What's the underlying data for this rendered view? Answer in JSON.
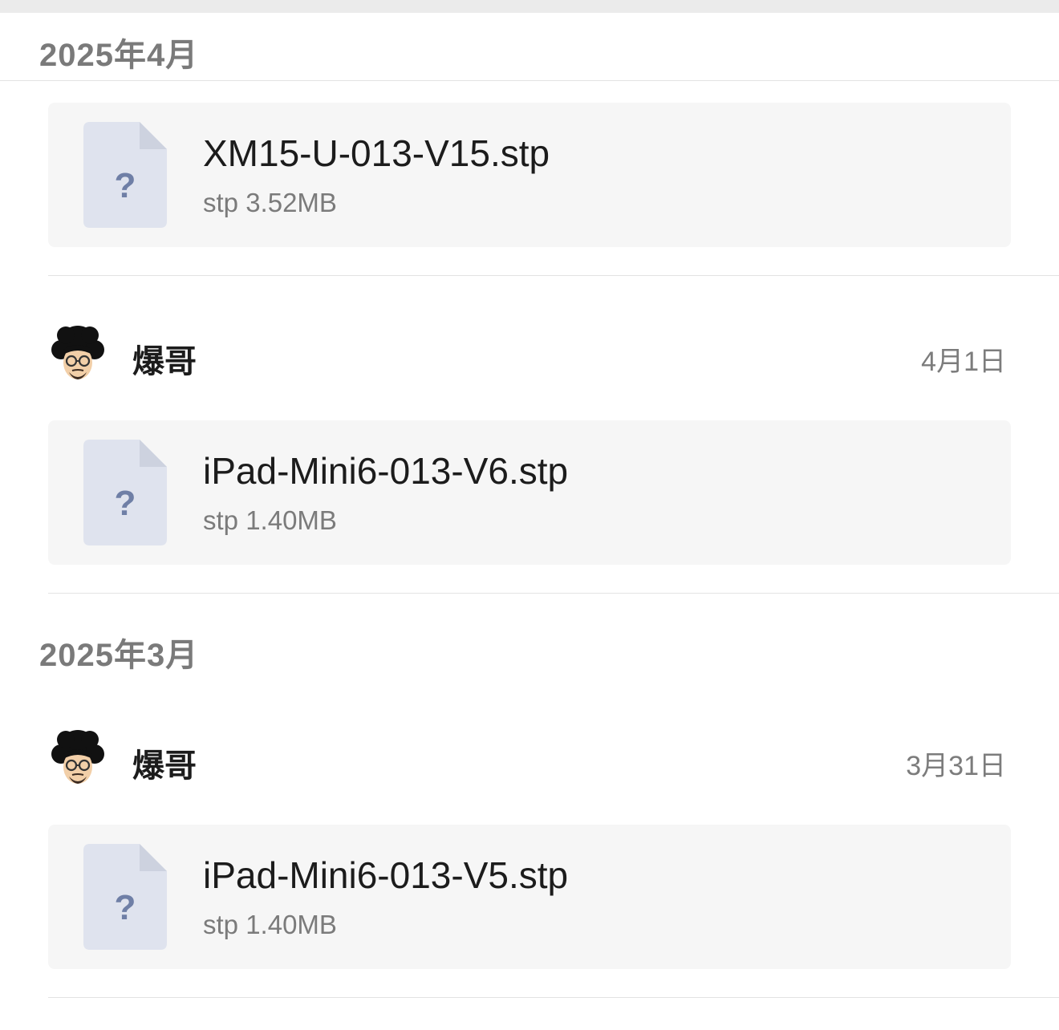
{
  "colors": {
    "background": "#ffffff",
    "card": "#f6f6f6",
    "icon_fill": "#dfe3ee",
    "icon_fold": "#cdd2df",
    "icon_question": "#6f7fa6",
    "muted_text": "#7a7a7a"
  },
  "sections": [
    {
      "month": "2025年4月"
    },
    {
      "month": "2025年3月"
    }
  ],
  "files": [
    {
      "name": "XM15-U-013-V15.stp",
      "meta": "stp 3.52MB",
      "icon": "unknown-file-icon",
      "icon_glyph": "?"
    },
    {
      "name": "iPad-Mini6-013-V6.stp",
      "meta": "stp 1.40MB",
      "icon": "unknown-file-icon",
      "icon_glyph": "?"
    },
    {
      "name": "iPad-Mini6-013-V5.stp",
      "meta": "stp 1.40MB",
      "icon": "unknown-file-icon",
      "icon_glyph": "?"
    }
  ],
  "senders": [
    {
      "name": "爆哥",
      "date": "4月1日",
      "avatar": "afro-avatar-icon"
    },
    {
      "name": "爆哥",
      "date": "3月31日",
      "avatar": "afro-avatar-icon"
    }
  ]
}
